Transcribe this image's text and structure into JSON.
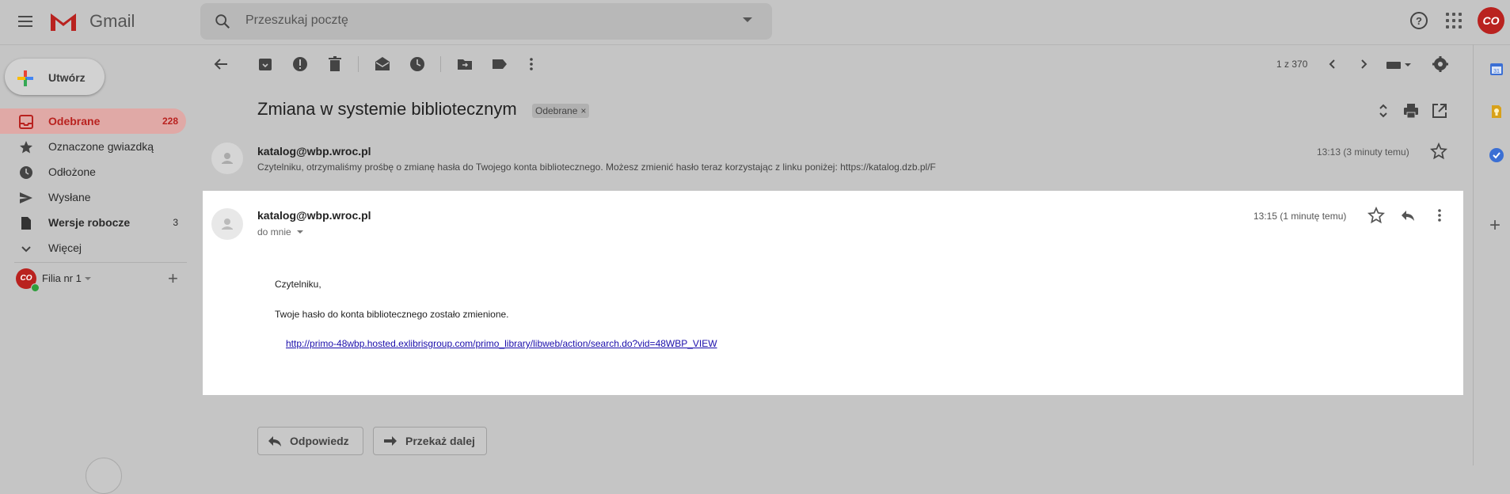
{
  "app": {
    "name": "Gmail",
    "account_initials": "CO"
  },
  "search": {
    "placeholder": "Przeszukaj pocztę"
  },
  "compose": {
    "label": "Utwórz"
  },
  "sidebar": {
    "items": [
      {
        "label": "Odebrane",
        "count": "228",
        "icon": "inbox-icon",
        "active": true
      },
      {
        "label": "Oznaczone gwiazdką",
        "count": "",
        "icon": "star-icon"
      },
      {
        "label": "Odłożone",
        "count": "",
        "icon": "clock-icon"
      },
      {
        "label": "Wysłane",
        "count": "",
        "icon": "send-icon"
      },
      {
        "label": "Wersje robocze",
        "count": "3",
        "icon": "draft-icon",
        "bold": true
      },
      {
        "label": "Więcej",
        "count": "",
        "icon": "chevron-down-icon"
      }
    ],
    "label_section": {
      "name": "Filia nr 1",
      "avatar_initials": "CO"
    }
  },
  "toolbar": {
    "pager": "1 z 370"
  },
  "thread": {
    "subject": "Zmiana w systemie bibliotecznym",
    "label_badge": "Odebrane",
    "messages": [
      {
        "sender": "katalog@wbp.wroc.pl",
        "time": "13:13 (3 minuty temu)",
        "snippet": "Czytelniku, otrzymaliśmy prośbę o zmianę hasła do Twojego konta bibliotecznego. Możesz zmienić hasło teraz korzystając z linku poniżej: https://katalog.dzb.pl/F"
      },
      {
        "sender": "katalog@wbp.wroc.pl",
        "time": "13:15 (1 minutę temu)",
        "to": "do mnie",
        "body_greeting": "Czytelniku,",
        "body_text": "Twoje hasło do konta bibliotecznego zostało zmienione.",
        "body_link": "http://primo-48wbp.hosted.exlibrisgroup.com/primo_library/libweb/action/search.do?vid=48WBP_VIEW"
      }
    ]
  },
  "actions": {
    "reply": "Odpowiedz",
    "forward": "Przekaż dalej"
  },
  "colors": {
    "accent": "#b9221f",
    "link": "#1a0dab",
    "background": "#c5c5c5"
  }
}
